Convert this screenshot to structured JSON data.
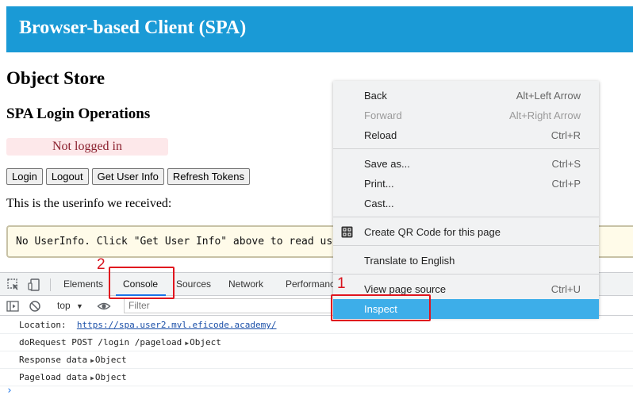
{
  "page": {
    "banner_title": "Browser-based Client (SPA)",
    "heading": "Object Store",
    "subheading": "SPA Login Operations",
    "status_text": "Not logged in",
    "buttons": [
      "Login",
      "Logout",
      "Get User Info",
      "Refresh Tokens"
    ],
    "userinfo_caption": "This is the userinfo we received:",
    "userinfo_box": "No UserInfo. Click \"Get User Info\" above to read user info"
  },
  "devtools": {
    "tabs": [
      "Elements",
      "Console",
      "Sources",
      "Network",
      "Performance"
    ],
    "active_tab": "Console",
    "context_selector": "top",
    "filter_placeholder": "Filter",
    "logs": [
      {
        "label": "Location:",
        "value": "https://spa.user2.mvl.eficode.academy/"
      },
      {
        "label": "doRequest POST /login /pageload",
        "value": "Object"
      },
      {
        "label": "Response data",
        "value": "Object"
      },
      {
        "label": "Pageload data",
        "value": "Object"
      }
    ]
  },
  "context_menu": {
    "items": [
      {
        "label": "Back",
        "shortcut": "Alt+Left Arrow",
        "disabled": false
      },
      {
        "label": "Forward",
        "shortcut": "Alt+Right Arrow",
        "disabled": true
      },
      {
        "label": "Reload",
        "shortcut": "Ctrl+R",
        "disabled": false
      },
      {
        "label": "Save as...",
        "shortcut": "Ctrl+S",
        "disabled": false
      },
      {
        "label": "Print...",
        "shortcut": "Ctrl+P",
        "disabled": false
      },
      {
        "label": "Cast...",
        "shortcut": "",
        "disabled": false
      },
      {
        "label": "Create QR Code for this page",
        "shortcut": "",
        "disabled": false,
        "icon": "qr-code-icon"
      },
      {
        "label": "Translate to English",
        "shortcut": "",
        "disabled": false
      },
      {
        "label": "View page source",
        "shortcut": "Ctrl+U",
        "disabled": false
      },
      {
        "label": "Inspect",
        "shortcut": "",
        "disabled": false,
        "highlighted": true
      }
    ]
  },
  "annotations": {
    "step_1": "1",
    "step_2": "2",
    "color": "#e0141e"
  }
}
